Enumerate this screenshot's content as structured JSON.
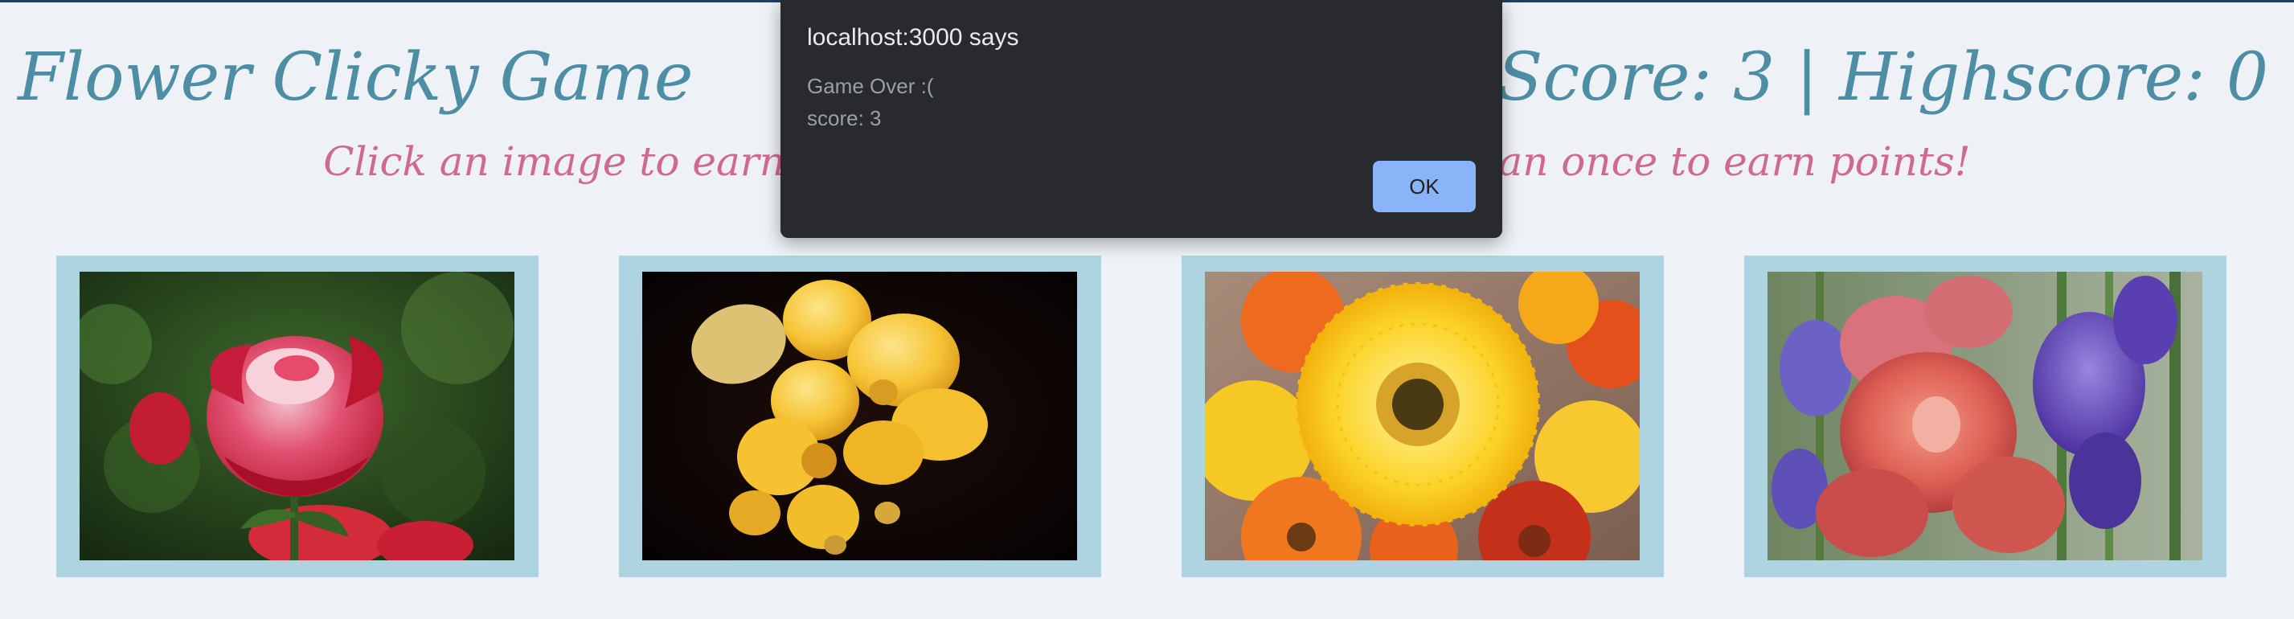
{
  "header": {
    "title": "Flower Clicky Game",
    "score_text": "Score: 3 | Highscore: 0"
  },
  "instructions": "Click an image to earn points, but don't click any more than once to earn points!",
  "cards": [
    {
      "subject": "red rose"
    },
    {
      "subject": "yellow freesia"
    },
    {
      "subject": "yellow gerbera daisies"
    },
    {
      "subject": "gladiolus and iris"
    }
  ],
  "dialog": {
    "title": "localhost:3000 says",
    "message_line1": "Game Over :(",
    "message_line2": "score: 3",
    "ok_label": "OK"
  },
  "colors": {
    "background": "#eef2f6",
    "title": "#4e8ea5",
    "instructions": "#cf6a8d",
    "card_frame": "#add4e0",
    "dialog_bg": "#292a2d",
    "ok_button": "#8ab4f8"
  }
}
